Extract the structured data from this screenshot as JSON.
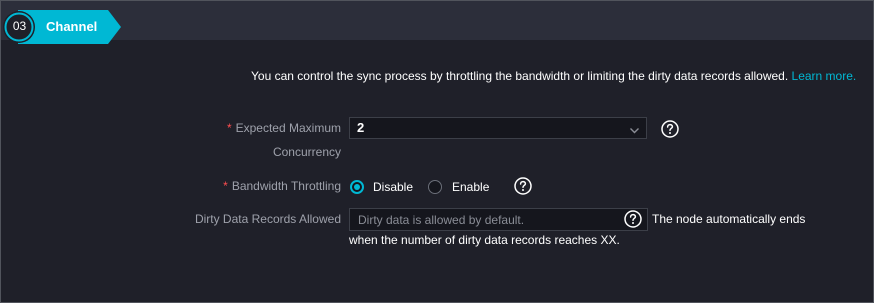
{
  "step": {
    "number": "03",
    "title": "Channel"
  },
  "info": {
    "text": "You can control the sync process by throttling the bandwidth or limiting the dirty data records allowed.",
    "link": "Learn more."
  },
  "fields": {
    "concurrency": {
      "label_line1": "Expected Maximum",
      "label_line2": "Concurrency",
      "value": "2"
    },
    "bandwidth": {
      "label": "Bandwidth Throttling",
      "option_disable": "Disable",
      "option_enable": "Enable",
      "selected": "Disable"
    },
    "dirty": {
      "label": "Dirty Data Records Allowed",
      "placeholder": "Dirty data is allowed by default.",
      "note_line1": "The node automatically ends",
      "note_line2": "when the number of dirty data records reaches XX."
    }
  },
  "required_mark": "*",
  "icons": {
    "help": "question-circle-icon",
    "chevron": "chevron-down-icon"
  },
  "colors": {
    "accent": "#00b8d4",
    "required": "#ff4d4f",
    "background": "#1f2029"
  }
}
